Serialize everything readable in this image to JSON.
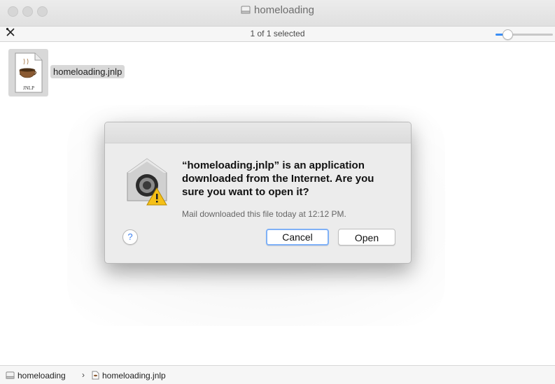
{
  "window": {
    "title": "homeloading"
  },
  "toolbar": {
    "selection_status": "1 of 1 selected",
    "icon_size_slider_level": 0.2
  },
  "files": [
    {
      "name": "homeloading.jnlp",
      "icon_label": "JNLP",
      "selected": true
    }
  ],
  "dialog": {
    "message": "“homeloading.jnlp” is an application downloaded from the Internet. Are you sure you want to open it?",
    "detail": "Mail downloaded this file today at 12:12 PM.",
    "help_label": "?",
    "cancel_label": "Cancel",
    "open_label": "Open"
  },
  "pathbar": {
    "folder": "homeloading",
    "separator": "›",
    "file": "homeloading.jnlp"
  },
  "colors": {
    "accent": "#3a8ef6",
    "default_button_ring": "#7fb1f7",
    "selection_bg": "#d8d8d8"
  }
}
